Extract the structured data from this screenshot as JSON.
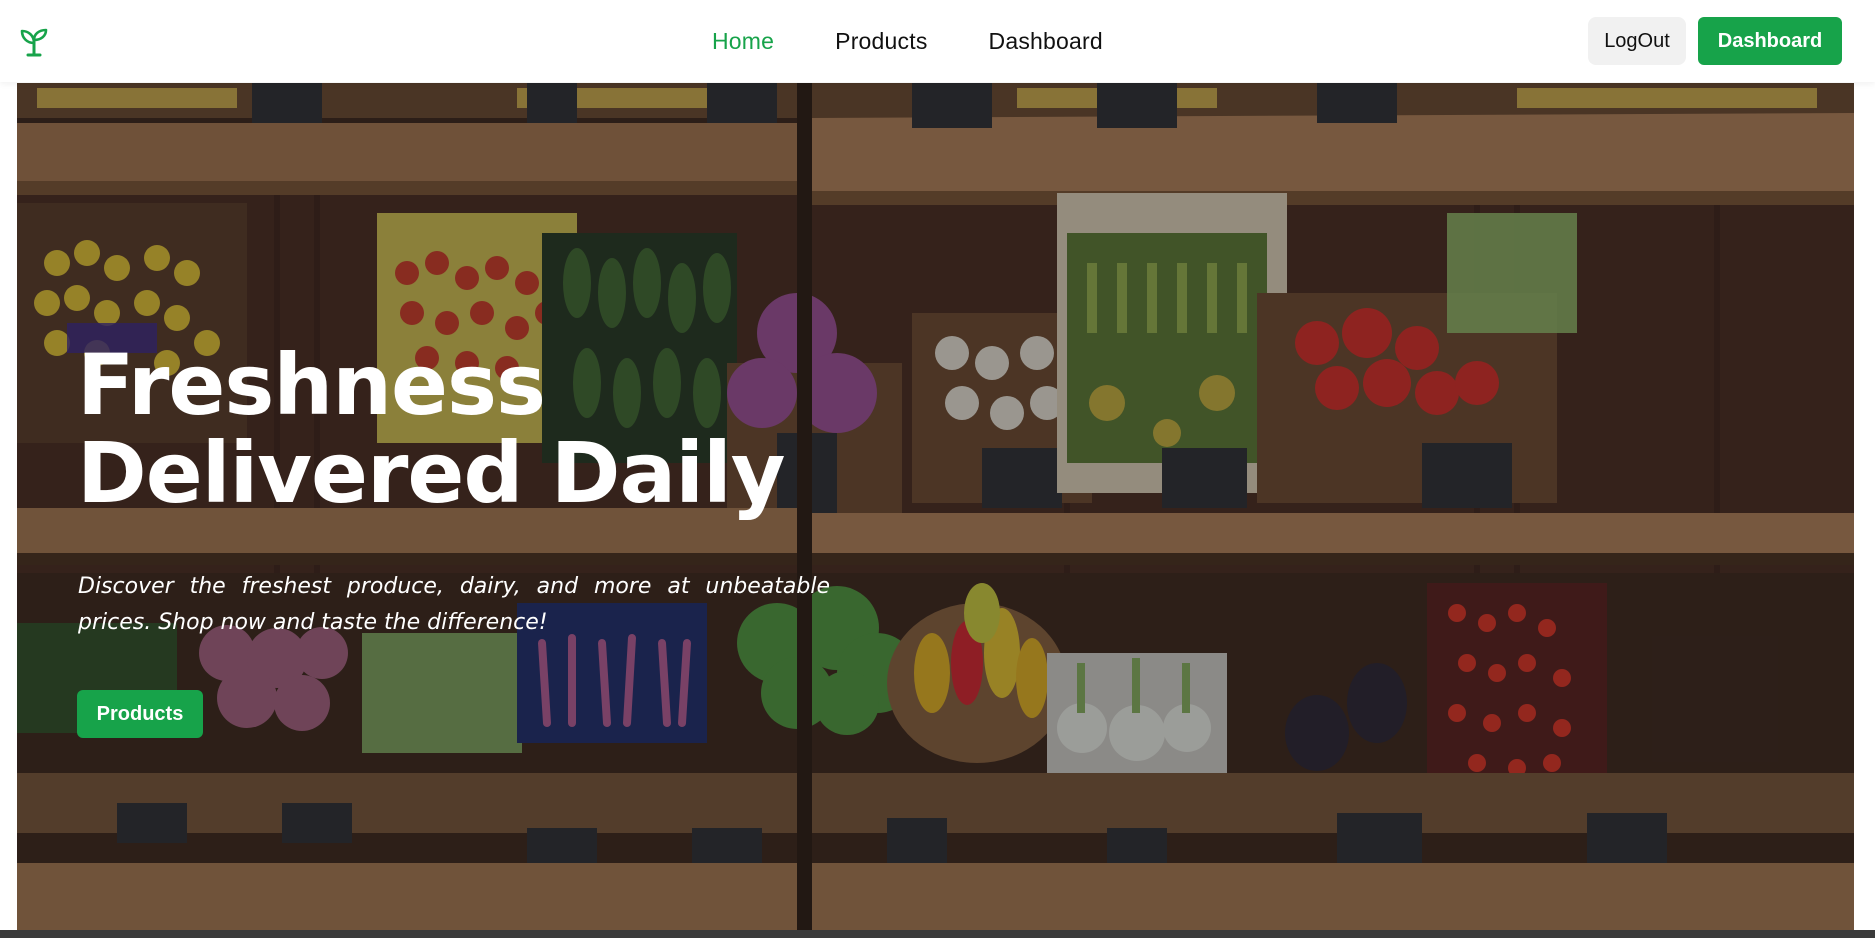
{
  "nav": {
    "links": [
      {
        "label": "Home",
        "active": true
      },
      {
        "label": "Products",
        "active": false
      },
      {
        "label": "Dashboard",
        "active": false
      }
    ],
    "logout_label": "LogOut",
    "dashboard_label": "Dashboard"
  },
  "hero": {
    "title_line1": "Freshness",
    "title_line2": "Delivered Daily",
    "subtitle": "Discover the freshest produce, dairy, and more at unbeatable prices. Shop now and taste the difference!",
    "cta_label": "Products",
    "background_image": "produce-shelves-photo"
  },
  "colors": {
    "accent": "#17a34a",
    "logout_bg": "#f1f1f1",
    "text": "#111111"
  },
  "icons": {
    "logo": "sprout-icon"
  }
}
